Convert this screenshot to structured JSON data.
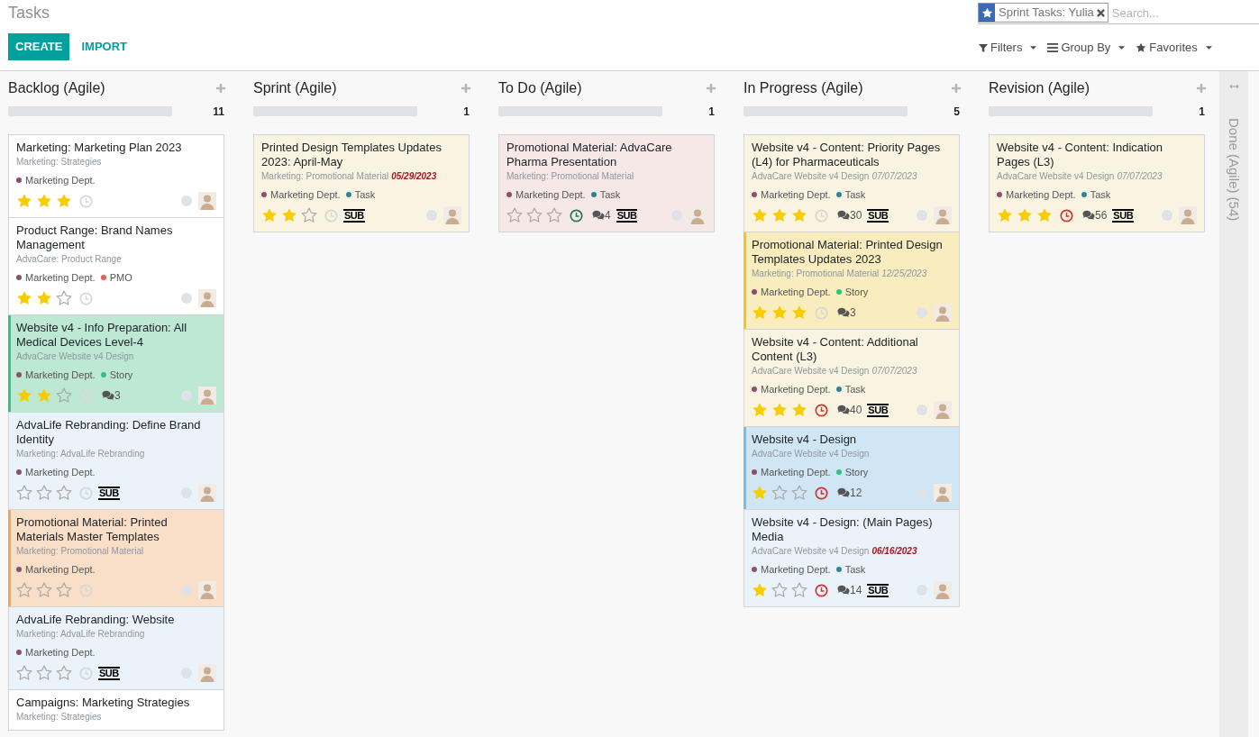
{
  "page": {
    "title": "Tasks"
  },
  "search": {
    "facets": [
      {
        "label": "Sprint Tasks: Yulia"
      }
    ],
    "placeholder": "Search..."
  },
  "buttons": [
    {
      "label": "CREATE",
      "kind": "primary"
    },
    {
      "label": "IMPORT",
      "kind": "link"
    }
  ],
  "search_options": [
    {
      "label": "Filters",
      "kind": "filter"
    },
    {
      "label": "Group By",
      "kind": "group"
    },
    {
      "label": "Favorites",
      "kind": "favorite"
    }
  ],
  "columns": [
    {
      "title": "Backlog (Agile)",
      "count": "11",
      "folded": false,
      "level": 1,
      "cards": [
        {
          "title": "Marketing: Marketing Plan 2023",
          "project": "Marketing: Strategies",
          "color": "#ffffff",
          "tags": [
            {
              "label": "Marketing Dept.",
              "color": "#8a4f6d"
            }
          ],
          "stars": 3,
          "activity": {
            "kind": "none"
          }
        },
        {
          "title": "Product Range: Brand Names Management",
          "project": "AdvaCare: Product Range",
          "color": "#ffffff",
          "tags": [
            {
              "label": "Marketing Dept.",
              "color": "#8a4f6d"
            },
            {
              "label": "PMO",
              "color": "#f0594f"
            }
          ],
          "stars": 2,
          "activity": {
            "kind": "none"
          }
        },
        {
          "title": "Website v4 - Info Preparation: All Medical Devices Level-4",
          "project": "AdvaCare Website v4 Design",
          "color": "#bde8d4",
          "stripe": {
            "color": "#30c381"
          },
          "tags": [
            {
              "label": "Marketing Dept.",
              "color": "#8a4f6d"
            },
            {
              "label": "Story",
              "color": "#30c381"
            }
          ],
          "stars": 2,
          "activity": {
            "kind": "none"
          },
          "comments": "3"
        },
        {
          "title": "AdvaLife Rebranding: Define Brand Identity",
          "project": "Marketing: AdvaLife Rebranding",
          "color": "#ebf3fa",
          "tags": [
            {
              "label": "Marketing Dept.",
              "color": "#8a4f6d"
            }
          ],
          "stars": 0,
          "activity": {
            "kind": "none"
          },
          "subtasks": "SUB"
        },
        {
          "title": "Promotional Material: Printed Materials Master Templates",
          "project": "Marketing: Promotional Material",
          "color": "#f9dfc8",
          "stripe": {
            "color": "#f4a460"
          },
          "tags": [
            {
              "label": "Marketing Dept.",
              "color": "#8a4f6d"
            }
          ],
          "stars": 0,
          "activity": {
            "kind": "none"
          }
        },
        {
          "title": "AdvaLife Rebranding: Website",
          "project": "Marketing: AdvaLife Rebranding",
          "color": "#ebf3fa",
          "tags": [
            {
              "label": "Marketing Dept.",
              "color": "#8a4f6d"
            }
          ],
          "stars": 0,
          "activity": {
            "kind": "none"
          },
          "subtasks": "SUB"
        },
        {
          "title": "Campaigns: Marketing Strategies",
          "project": "Marketing: Strategies",
          "color": "#ffffff"
        }
      ]
    },
    {
      "title": "Sprint (Agile)",
      "count": "1",
      "folded": false,
      "level": 1,
      "cards": [
        {
          "title": "Printed Design Templates Updates 2023: April-May",
          "project": "Marketing: Promotional Material",
          "deadline": "05/29/2023",
          "deadline_overdue": true,
          "color": "#f8f4e1",
          "tags": [
            {
              "label": "Marketing Dept.",
              "color": "#8a4f6d"
            },
            {
              "label": "Task",
              "color": "#2c8397"
            }
          ],
          "stars": 2,
          "activity": {
            "kind": "none"
          },
          "subtasks": "SUB"
        }
      ]
    },
    {
      "title": "To Do (Agile)",
      "count": "1",
      "folded": false,
      "level": 1,
      "cards": [
        {
          "title": "Promotional Material: AdvaCare Pharma Presentation",
          "project": "Marketing: Promotional Material",
          "color": "#f7e8e8",
          "tags": [
            {
              "label": "Marketing Dept.",
              "color": "#8a4f6d"
            },
            {
              "label": "Task",
              "color": "#2c8397"
            }
          ],
          "stars": 0,
          "activity": {
            "kind": "planned"
          },
          "comments": "4",
          "subtasks": "SUB"
        }
      ]
    },
    {
      "title": "In Progress (Agile)",
      "count": "5",
      "folded": false,
      "level": 1,
      "cards": [
        {
          "title": "Website v4 - Content: Priority Pages (L4) for Pharmaceuticals",
          "project": "AdvaCare Website v4 Design",
          "deadline": "07/07/2023",
          "deadline_overdue": false,
          "color": "#f8f4e1",
          "tags": [
            {
              "label": "Marketing Dept.",
              "color": "#8a4f6d"
            },
            {
              "label": "Task",
              "color": "#2c8397"
            }
          ],
          "stars": 3,
          "activity": {
            "kind": "none"
          },
          "comments": "30",
          "subtasks": "SUB"
        },
        {
          "title": "Promotional Material: Printed Design Templates Updates 2023",
          "project": "Marketing: Promotional Material",
          "deadline": "12/25/2023",
          "deadline_overdue": false,
          "color": "#f9ecbe",
          "stripe": {
            "color": "#f5c518"
          },
          "tags": [
            {
              "label": "Marketing Dept.",
              "color": "#8a4f6d"
            },
            {
              "label": "Story",
              "color": "#30c381"
            }
          ],
          "stars": 3,
          "activity": {
            "kind": "none"
          },
          "comments": "3"
        },
        {
          "title": "Website v4 - Content: Additional Content (L3)",
          "project": "AdvaCare Website v4 Design",
          "deadline": "07/07/2023",
          "deadline_overdue": false,
          "color": "#f8f4e1",
          "tags": [
            {
              "label": "Marketing Dept.",
              "color": "#8a4f6d"
            },
            {
              "label": "Task",
              "color": "#2c8397"
            }
          ],
          "stars": 3,
          "activity": {
            "kind": "overdue"
          },
          "comments": "40",
          "subtasks": "SUB"
        },
        {
          "title": "Website v4 - Design",
          "project": "AdvaCare Website v4 Design",
          "color": "#d0e6f5",
          "stripe": {
            "color": "#6cc1ed"
          },
          "tags": [
            {
              "label": "Marketing Dept.",
              "color": "#8a4f6d"
            },
            {
              "label": "Story",
              "color": "#30c381"
            }
          ],
          "stars": 1,
          "activity": {
            "kind": "overdue"
          },
          "comments": "12"
        },
        {
          "title": "Website v4 - Design: (Main Pages) Media",
          "project": "AdvaCare Website v4 Design",
          "deadline": "06/16/2023",
          "deadline_overdue": true,
          "color": "#ebf3fa",
          "tags": [
            {
              "label": "Marketing Dept.",
              "color": "#8a4f6d"
            },
            {
              "label": "Task",
              "color": "#2c8397"
            }
          ],
          "stars": 1,
          "activity": {
            "kind": "overdue"
          },
          "comments": "14",
          "subtasks": "SUB"
        }
      ]
    },
    {
      "title": "Revision (Agile)",
      "count": "1",
      "folded": false,
      "level": 1,
      "cards": [
        {
          "title": "Website v4 - Content: Indication Pages (L3)",
          "project": "AdvaCare Website v4 Design",
          "deadline": "07/07/2023",
          "deadline_overdue": false,
          "color": "#f8f4e1",
          "tags": [
            {
              "label": "Marketing Dept.",
              "color": "#8a4f6d"
            },
            {
              "label": "Task",
              "color": "#2c8397"
            }
          ],
          "stars": 3,
          "activity": {
            "kind": "overdue"
          },
          "comments": "56",
          "subtasks": "SUB"
        }
      ]
    },
    {
      "title": "Done (Agile) (54)",
      "folded": true
    }
  ]
}
